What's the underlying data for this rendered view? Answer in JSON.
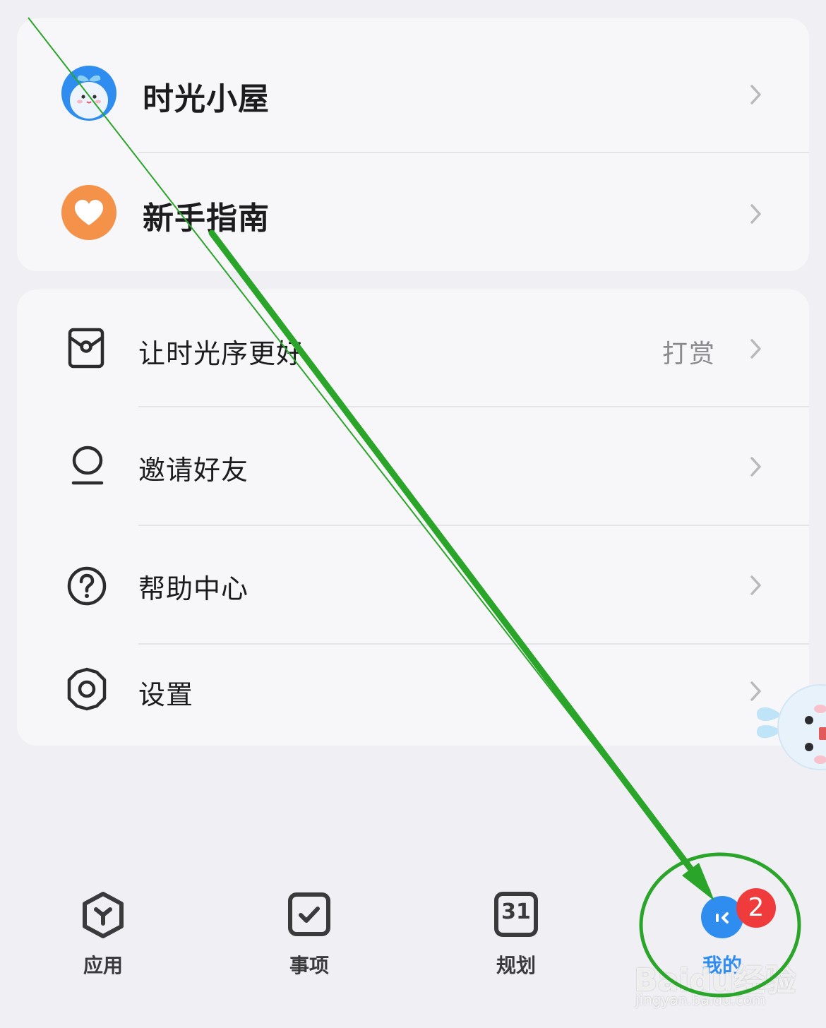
{
  "top_card": {
    "items": [
      {
        "label": "时光小屋",
        "icon": "mascot-avatar-icon"
      },
      {
        "label": "新手指南",
        "icon": "heart-icon",
        "icon_color": "#f4924a"
      }
    ]
  },
  "bottom_card": {
    "items": [
      {
        "label": "让时光序更好",
        "trailing": "打赏",
        "icon": "gift-card-icon"
      },
      {
        "label": "邀请好友",
        "icon": "person-icon"
      },
      {
        "label": "帮助中心",
        "icon": "help-circle-icon"
      },
      {
        "label": "设置",
        "icon": "gear-icon"
      }
    ]
  },
  "bottom_nav": {
    "items": [
      {
        "label": "应用",
        "icon": "apps-hexagon-icon"
      },
      {
        "label": "事项",
        "icon": "checkbox-icon"
      },
      {
        "label": "规划",
        "icon": "calendar-icon",
        "icon_text": "31"
      },
      {
        "label": "我的",
        "icon": "profile-face-icon",
        "badge": "2",
        "active": true
      }
    ]
  },
  "colors": {
    "accent": "#2f8df0",
    "badge": "#ef3b3b",
    "annotation_green": "#2aa52a"
  },
  "watermark": {
    "brand": "Baidu经验",
    "url": "jingyan.baidu.com"
  }
}
